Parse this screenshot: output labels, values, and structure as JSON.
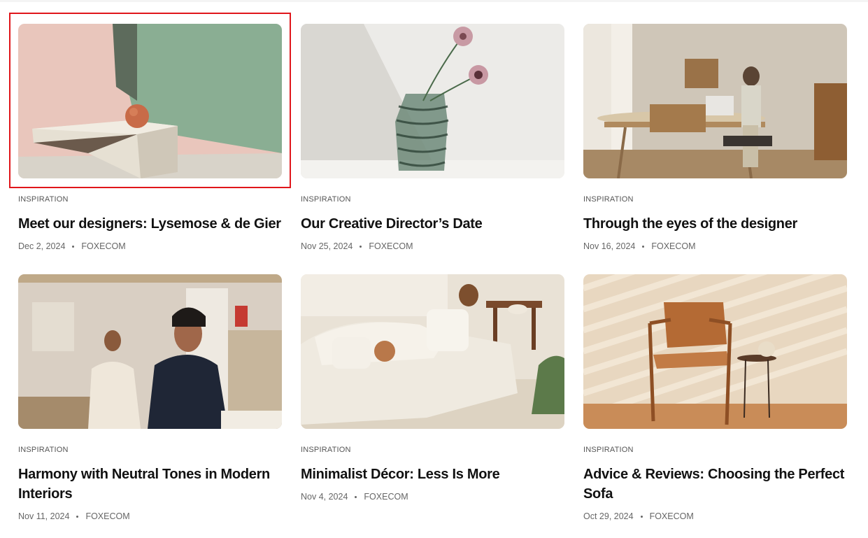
{
  "posts": [
    {
      "category": "INSPIRATION",
      "title": "Meet our designers: Lysemose & de Gier",
      "date": "Dec 2, 2024",
      "author": "FOXECOM",
      "image": "Pink wall with green panel, white low table and terracotta sphere"
    },
    {
      "category": "INSPIRATION",
      "title": "Our Creative Director’s Date",
      "date": "Nov 25, 2024",
      "author": "FOXECOM",
      "image": "Green ribbed glass vase with two pink flowers"
    },
    {
      "category": "INSPIRATION",
      "title": "Through the eyes of the designer",
      "date": "Nov 16, 2024",
      "author": "FOXECOM",
      "image": "Studio room with wooden desk, chair and person walking"
    },
    {
      "category": "INSPIRATION",
      "title": "Harmony with Neutral Tones in Modern Interiors",
      "date": "Nov 11, 2024",
      "author": "FOXECOM",
      "image": "Two designers in a sunlit studio"
    },
    {
      "category": "INSPIRATION",
      "title": "Minimalist Décor: Less Is More",
      "date": "Nov 4, 2024",
      "author": "FOXECOM",
      "image": "White sectional sofa with cushions on a rug"
    },
    {
      "category": "INSPIRATION",
      "title": "Advice & Reviews: Choosing the Perfect Sofa",
      "date": "Oct 29, 2024",
      "author": "FOXECOM",
      "image": "Wooden lounge chair with leather seat and side table in striped sunlight"
    }
  ],
  "highlight_color": "#e0161b"
}
